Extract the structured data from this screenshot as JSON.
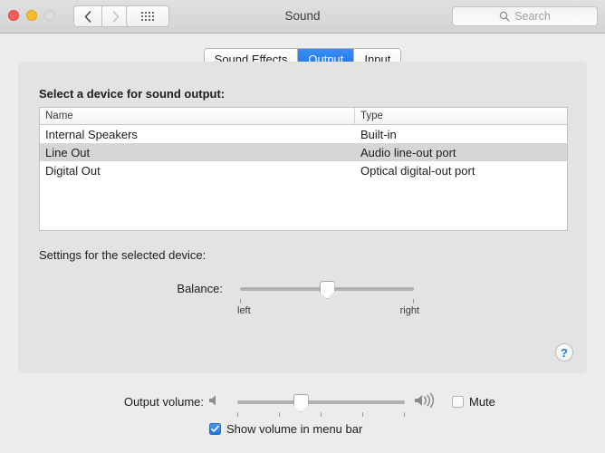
{
  "window": {
    "title": "Sound",
    "traffic_lights": [
      "close",
      "minimize",
      "zoom"
    ]
  },
  "toolbar": {
    "back_label": "‹",
    "forward_label": "›",
    "grid_name": "show-all-icon",
    "search": {
      "placeholder": "Search",
      "value": "",
      "icon": "search-icon"
    }
  },
  "tabs": [
    {
      "label": "Sound Effects",
      "active": false
    },
    {
      "label": "Output",
      "active": true
    },
    {
      "label": "Input",
      "active": false
    }
  ],
  "main": {
    "device_section_label": "Select a device for sound output:",
    "table": {
      "columns": [
        "Name",
        "Type"
      ],
      "rows": [
        {
          "name": "Internal Speakers",
          "type": "Built-in",
          "selected": false
        },
        {
          "name": "Line Out",
          "type": "Audio line-out port",
          "selected": true
        },
        {
          "name": "Digital Out",
          "type": "Optical digital-out port",
          "selected": false
        }
      ]
    },
    "settings_label": "Settings for the selected device:",
    "balance": {
      "label": "Balance:",
      "left_label": "left",
      "right_label": "right",
      "value_percent": 50
    },
    "help_button": {
      "label": "?",
      "icon": "question-mark-icon"
    }
  },
  "footer": {
    "output_volume_label": "Output volume:",
    "volume_percent": 38,
    "speaker_low_icon": "speaker-mute-icon",
    "speaker_high_icon": "speaker-loud-icon",
    "mute": {
      "label": "Mute",
      "checked": false
    },
    "show_volume_menu_bar": {
      "label": "Show volume in menu bar",
      "checked": true
    }
  },
  "colors": {
    "accent_blue": "#1a72e8",
    "window_bg": "#ececec",
    "panel_bg": "#e3e3e3",
    "selection_grey": "#d6d6d6"
  }
}
